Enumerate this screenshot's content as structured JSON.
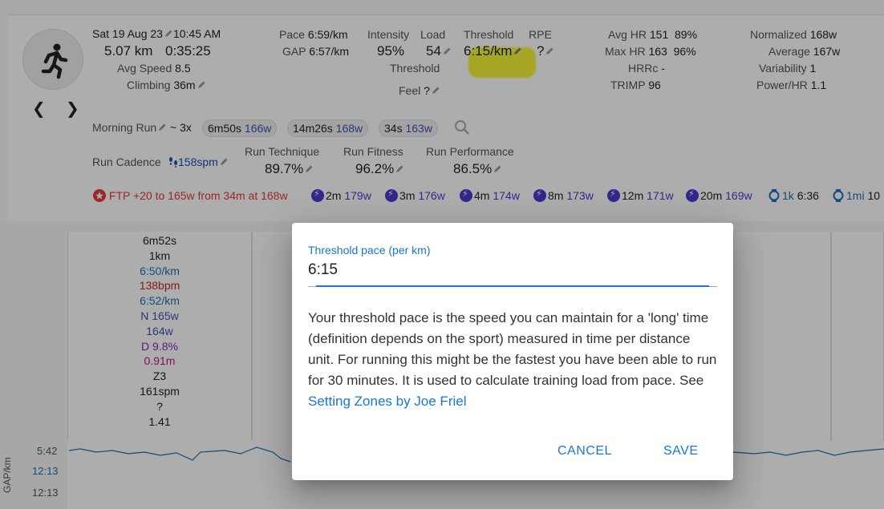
{
  "activity": {
    "date_time": "Sat 19 Aug 23",
    "time": "10:45 AM",
    "distance": "5.07 km",
    "duration": "0:35:25",
    "avg_speed_label": "Avg Speed",
    "avg_speed": "8.5",
    "climbing_label": "Climbing",
    "climbing": "36m",
    "pace_label": "Pace",
    "pace": "6:59/km",
    "gap_label": "GAP",
    "gap": "6:57/km",
    "intensity_label": "Intensity",
    "intensity": "95%",
    "load_label": "Load",
    "load": "54",
    "threshold_label": "Threshold",
    "threshold": "6:15/km",
    "rpe_label": "RPE",
    "rpe": "?",
    "threshold2_label": "Threshold",
    "feel_label": "Feel",
    "feel": "?",
    "avg_hr_label": "Avg HR",
    "avg_hr": "151",
    "avg_hr_pct": "89%",
    "max_hr_label": "Max HR",
    "max_hr": "163",
    "max_hr_pct": "96%",
    "hrrc_label": "HRRc",
    "hrrc": "-",
    "trimp_label": "TRIMP",
    "trimp": "96",
    "normalized_label": "Normalized",
    "normalized": "168w",
    "average_label": "Average",
    "average": "167w",
    "variability_label": "Variability",
    "variability": "1",
    "power_hr_label": "Power/HR",
    "power_hr": "1.1",
    "name": "Morning Run",
    "intervals_prefix": "~ 3x",
    "chips": [
      {
        "time": "6m50s",
        "watts": "166w"
      },
      {
        "time": "14m26s",
        "watts": "168w"
      },
      {
        "time": "34s",
        "watts": "163w"
      }
    ],
    "cadence_label": "Run Cadence",
    "cadence": "158spm",
    "technique_label": "Run Technique",
    "technique": "89.7%",
    "fitness_label": "Run Fitness",
    "fitness": "96.2%",
    "performance_label": "Run Performance",
    "performance": "86.5%",
    "ftp_text": "FTP +20 to 165w from 34m at 168w",
    "bests": [
      {
        "dur": "2m",
        "watts": "179w"
      },
      {
        "dur": "3m",
        "watts": "176w"
      },
      {
        "dur": "4m",
        "watts": "174w"
      },
      {
        "dur": "8m",
        "watts": "173w"
      },
      {
        "dur": "12m",
        "watts": "171w"
      },
      {
        "dur": "20m",
        "watts": "169w"
      }
    ],
    "pace_bests": [
      {
        "dist": "1k",
        "time": "6:36"
      },
      {
        "dist": "1mi",
        "time": "10"
      }
    ]
  },
  "interval": {
    "lines": [
      "6m52s",
      "1km",
      "6:50/km",
      "138bpm",
      "6:52/km",
      "N 165w",
      "164w",
      "D 9.8%",
      "0.91m",
      "Z3",
      "161spm",
      "?",
      "1.41"
    ],
    "colors": [
      "#222",
      "#222",
      "#1a73b8",
      "#c62828",
      "#1a73b8",
      "#3f51b5",
      "#3f51b5",
      "#7b2fbf",
      "#c2188a",
      "#222",
      "#222",
      "#222",
      "#222"
    ]
  },
  "chart": {
    "y_label": "GAP/km",
    "ticks": [
      "5:42",
      "12:13",
      "12:13"
    ]
  },
  "dialog": {
    "field_label": "Threshold pace (per km)",
    "field_value": "6:15",
    "description": "Your threshold pace is the speed you can maintain for a 'long' time (definition depends on the sport) measured in time per distance unit. For running this might be the fastest you have been able to run for 30 minutes. It is used to calculate training load from pace. See",
    "link_text": "Setting Zones by Joe Friel",
    "cancel_label": "CANCEL",
    "save_label": "SAVE"
  }
}
